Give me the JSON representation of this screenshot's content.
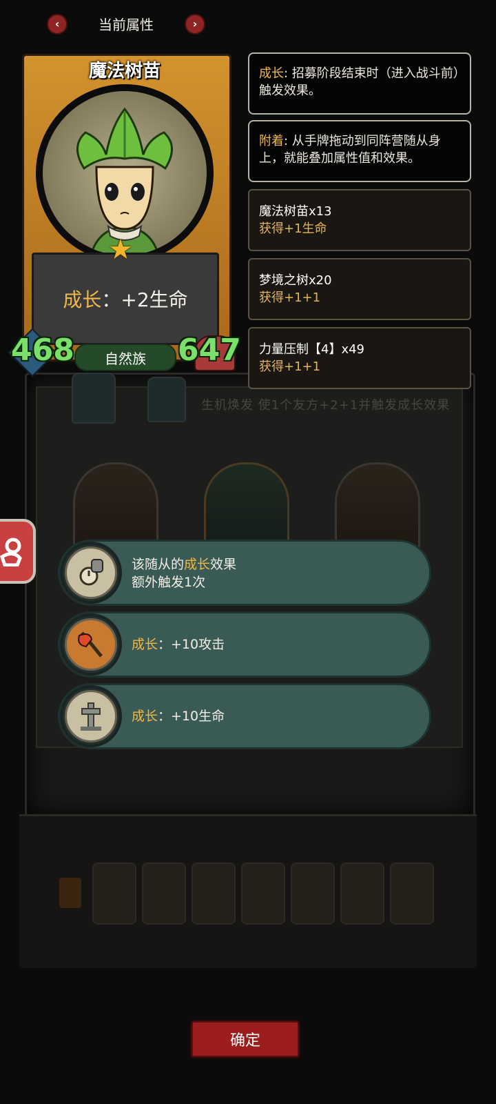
{
  "header": {
    "title": "当前属性",
    "prev_icon": "chevron-left-icon",
    "next_icon": "chevron-right-icon"
  },
  "card": {
    "name": "魔法树苗",
    "rarity_icon": "star-icon",
    "ability_keyword": "成长",
    "ability_sep": "：",
    "ability_effect": "+2生命",
    "attack": "468",
    "health": "647",
    "tribe": "自然族"
  },
  "info": [
    {
      "keyword": "成长",
      "text": ": 招募阶段结束时（进入战斗前）触发效果。"
    },
    {
      "keyword": "附着",
      "text": ": 从手牌拖动到同阵营随从身上，就能叠加属性值和效果。"
    }
  ],
  "sources": [
    {
      "name": "魔法树苗x13",
      "gain": "获得+1生命"
    },
    {
      "name": "梦境之树x20",
      "gain": "获得+1+1"
    },
    {
      "name": "力量压制【4】x49",
      "gain": "获得+1+1"
    }
  ],
  "background": {
    "skill_text": "生机焕发 使1个友方+2+1并触发成长效果"
  },
  "options": [
    {
      "line1_prefix": "该随从的",
      "line1_keyword": "成长",
      "line1_suffix": "效果",
      "line2": "额外触发1次",
      "icon": "gauntlet-stopwatch-icon"
    },
    {
      "keyword": "成长",
      "text": "：+10攻击",
      "icon": "battle-axe-icon"
    },
    {
      "keyword": "成长",
      "text": "：+10生命",
      "icon": "tombstone-cross-icon"
    }
  ],
  "confirm_label": "确定",
  "colors": {
    "keyword": "#f0b84a",
    "stat_green": "#7be06a",
    "option_bg": "#3a5a55",
    "confirm_red": "#9c1d1d"
  }
}
